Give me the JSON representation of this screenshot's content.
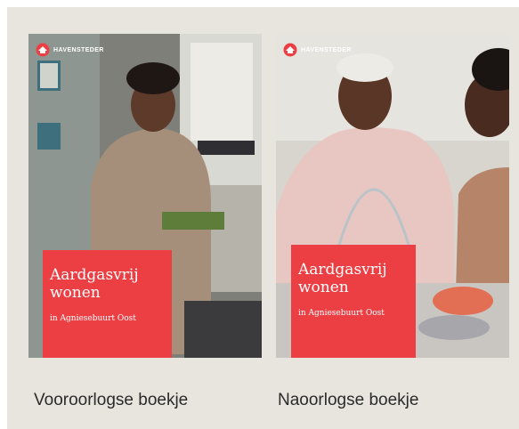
{
  "items": [
    {
      "brand": "HAVENSTEDER",
      "title_line1": "Aardgasvrij",
      "title_line2": "wonen",
      "subtitle": "in Agniesebuurt Oost",
      "caption": "Vooroorlogse boekje"
    },
    {
      "brand": "HAVENSTEDER",
      "title_line1": "Aardgasvrij",
      "title_line2": "wonen",
      "subtitle": "in Agniesebuurt Oost",
      "caption": "Naoorlogse boekje"
    }
  ],
  "colors": {
    "panel": "#e8e4de",
    "accent_red": "#ec3f44",
    "caption_text": "#2b2b2b"
  },
  "icons": [
    "havensteder-logo-icon"
  ]
}
